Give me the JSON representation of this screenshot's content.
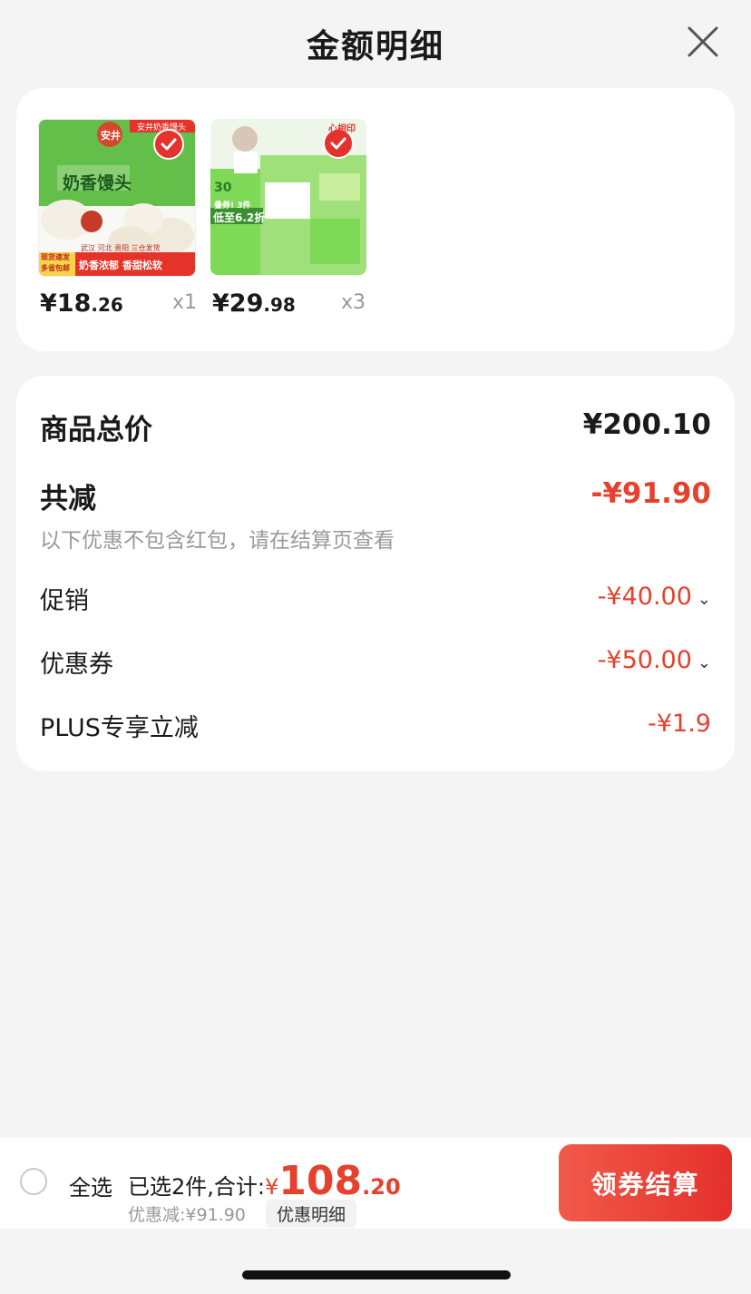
{
  "header": {
    "title": "金额明细"
  },
  "products": [
    {
      "image_label": "奶香馒头",
      "image_tag": "安井奶香馒头",
      "image_slogan": "奶香浓郁 香甜松软",
      "image_brand": "安井",
      "image_badge": "现货速发 多省包邮",
      "image_region": "武汉 河北 贵阳 三仓发货",
      "price_int": "¥18",
      "price_dec": ".26",
      "qty": "x1"
    },
    {
      "image_label": "低至6.2折",
      "image_tag": "30",
      "image_badge": "叠券! 3件",
      "image_brand": "心相印",
      "price_int": "¥29",
      "price_dec": ".98",
      "qty": "x3"
    }
  ],
  "summary": {
    "total_label": "商品总价",
    "total_value": "¥200.10",
    "reduce_label": "共减",
    "reduce_value": "-¥91.90",
    "note": "以下优惠不包含红包，请在结算页查看",
    "promo_label": "促销",
    "promo_value": "-¥40.00",
    "coupon_label": "优惠券",
    "coupon_value": "-¥50.00",
    "plus_label": "PLUS专享立减",
    "plus_value": "-¥1.9"
  },
  "bottom": {
    "select_all": "全选",
    "selected_text": "已选2件,合计:",
    "total_cur": "¥",
    "total_int": "108",
    "total_dec": ".20",
    "discount_text": "优惠减:¥91.90",
    "detail_button": "优惠明细",
    "checkout_button": "领券结算"
  },
  "colors": {
    "accent": "#e5412d",
    "check": "#e5322d",
    "product1_bg": "#63bf49",
    "product2_bg": "#7ed957"
  }
}
